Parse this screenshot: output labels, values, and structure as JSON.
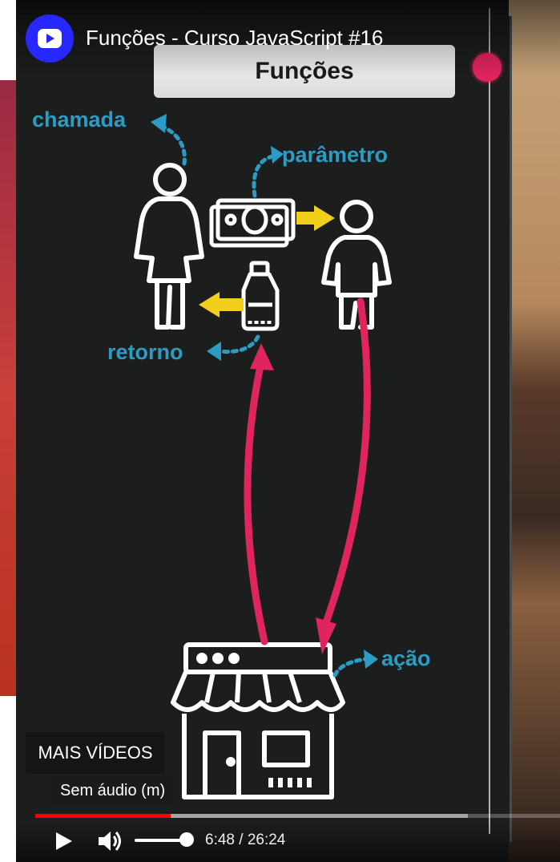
{
  "player": {
    "video_title": "Funções - Curso JavaScript #16",
    "channel_icon": "play-logo-icon",
    "more_videos_label": "MAIS VÍDEOS",
    "mute_tooltip": "Sem áudio (m)",
    "current_time": "6:48",
    "separator": " / ",
    "duration": "26:24",
    "progress_fraction": 0.258,
    "buffered_fraction": 0.825,
    "volume_fraction": 1.0
  },
  "slide": {
    "title": "Funções",
    "labels": {
      "call": "chamada",
      "parameter": "parâmetro",
      "return": "retorno",
      "action": "ação"
    }
  },
  "colors": {
    "accent_blue": "#2d9cc4",
    "arrow_yellow": "#f2cf1a",
    "arrow_pink": "#e0245e",
    "progress_red": "#ff0000",
    "channel_blue": "#2727ff"
  }
}
